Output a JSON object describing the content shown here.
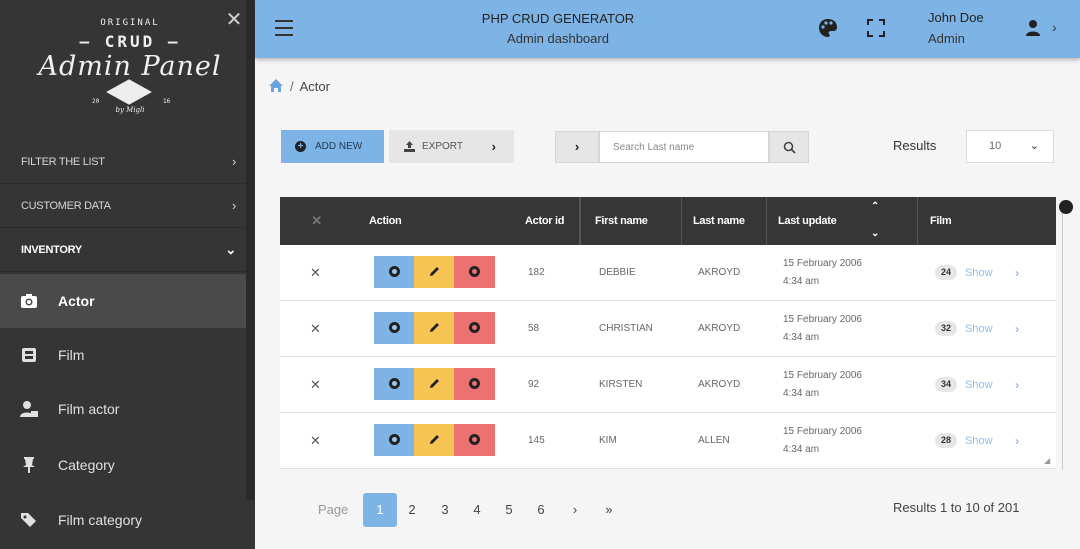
{
  "sidebar": {
    "logo": {
      "line1": "ORIGINAL",
      "line2": "– CRUD –",
      "line3": "Admin Panel",
      "year_left": "20",
      "year_right": "16",
      "by": "by Migli"
    },
    "sections": [
      {
        "label": "FILTER THE LIST"
      },
      {
        "label": "CUSTOMER DATA"
      },
      {
        "label": "INVENTORY"
      }
    ],
    "items": [
      {
        "label": "Actor"
      },
      {
        "label": "Film"
      },
      {
        "label": "Film actor"
      },
      {
        "label": "Category"
      },
      {
        "label": "Film category"
      }
    ]
  },
  "header": {
    "title": "PHP CRUD GENERATOR",
    "subtitle": "Admin dashboard",
    "user_name": "John Doe",
    "user_role": "Admin"
  },
  "breadcrumb": {
    "current": "Actor"
  },
  "toolbar": {
    "add_label": "ADD NEW",
    "export_label": "EXPORT",
    "search_placeholder": "Search Last name",
    "results_label": "Results",
    "results_value": "10"
  },
  "table": {
    "headers": {
      "action": "Action",
      "actor_id": "Actor id",
      "first_name": "First name",
      "last_name": "Last name",
      "last_update": "Last update",
      "film": "Film"
    },
    "rows": [
      {
        "actor_id": "182",
        "first_name": "DEBBIE",
        "last_name": "AKROYD",
        "date": "15 February 2006",
        "time": "4:34 am",
        "film_count": "24",
        "film_show": "Show"
      },
      {
        "actor_id": "58",
        "first_name": "CHRISTIAN",
        "last_name": "AKROYD",
        "date": "15 February 2006",
        "time": "4:34 am",
        "film_count": "32",
        "film_show": "Show"
      },
      {
        "actor_id": "92",
        "first_name": "KIRSTEN",
        "last_name": "AKROYD",
        "date": "15 February 2006",
        "time": "4:34 am",
        "film_count": "34",
        "film_show": "Show"
      },
      {
        "actor_id": "145",
        "first_name": "KIM",
        "last_name": "ALLEN",
        "date": "15 February 2006",
        "time": "4:34 am",
        "film_count": "28",
        "film_show": "Show"
      }
    ]
  },
  "pagination": {
    "label": "Page",
    "pages": [
      "1",
      "2",
      "3",
      "4",
      "5",
      "6"
    ],
    "next": "›",
    "last": "»",
    "info": "Results 1 to 10 of 201"
  },
  "colors": {
    "accent": "#7eb4e5",
    "sidebar": "#353535",
    "edit": "#f5c453",
    "delete": "#ec7272"
  }
}
